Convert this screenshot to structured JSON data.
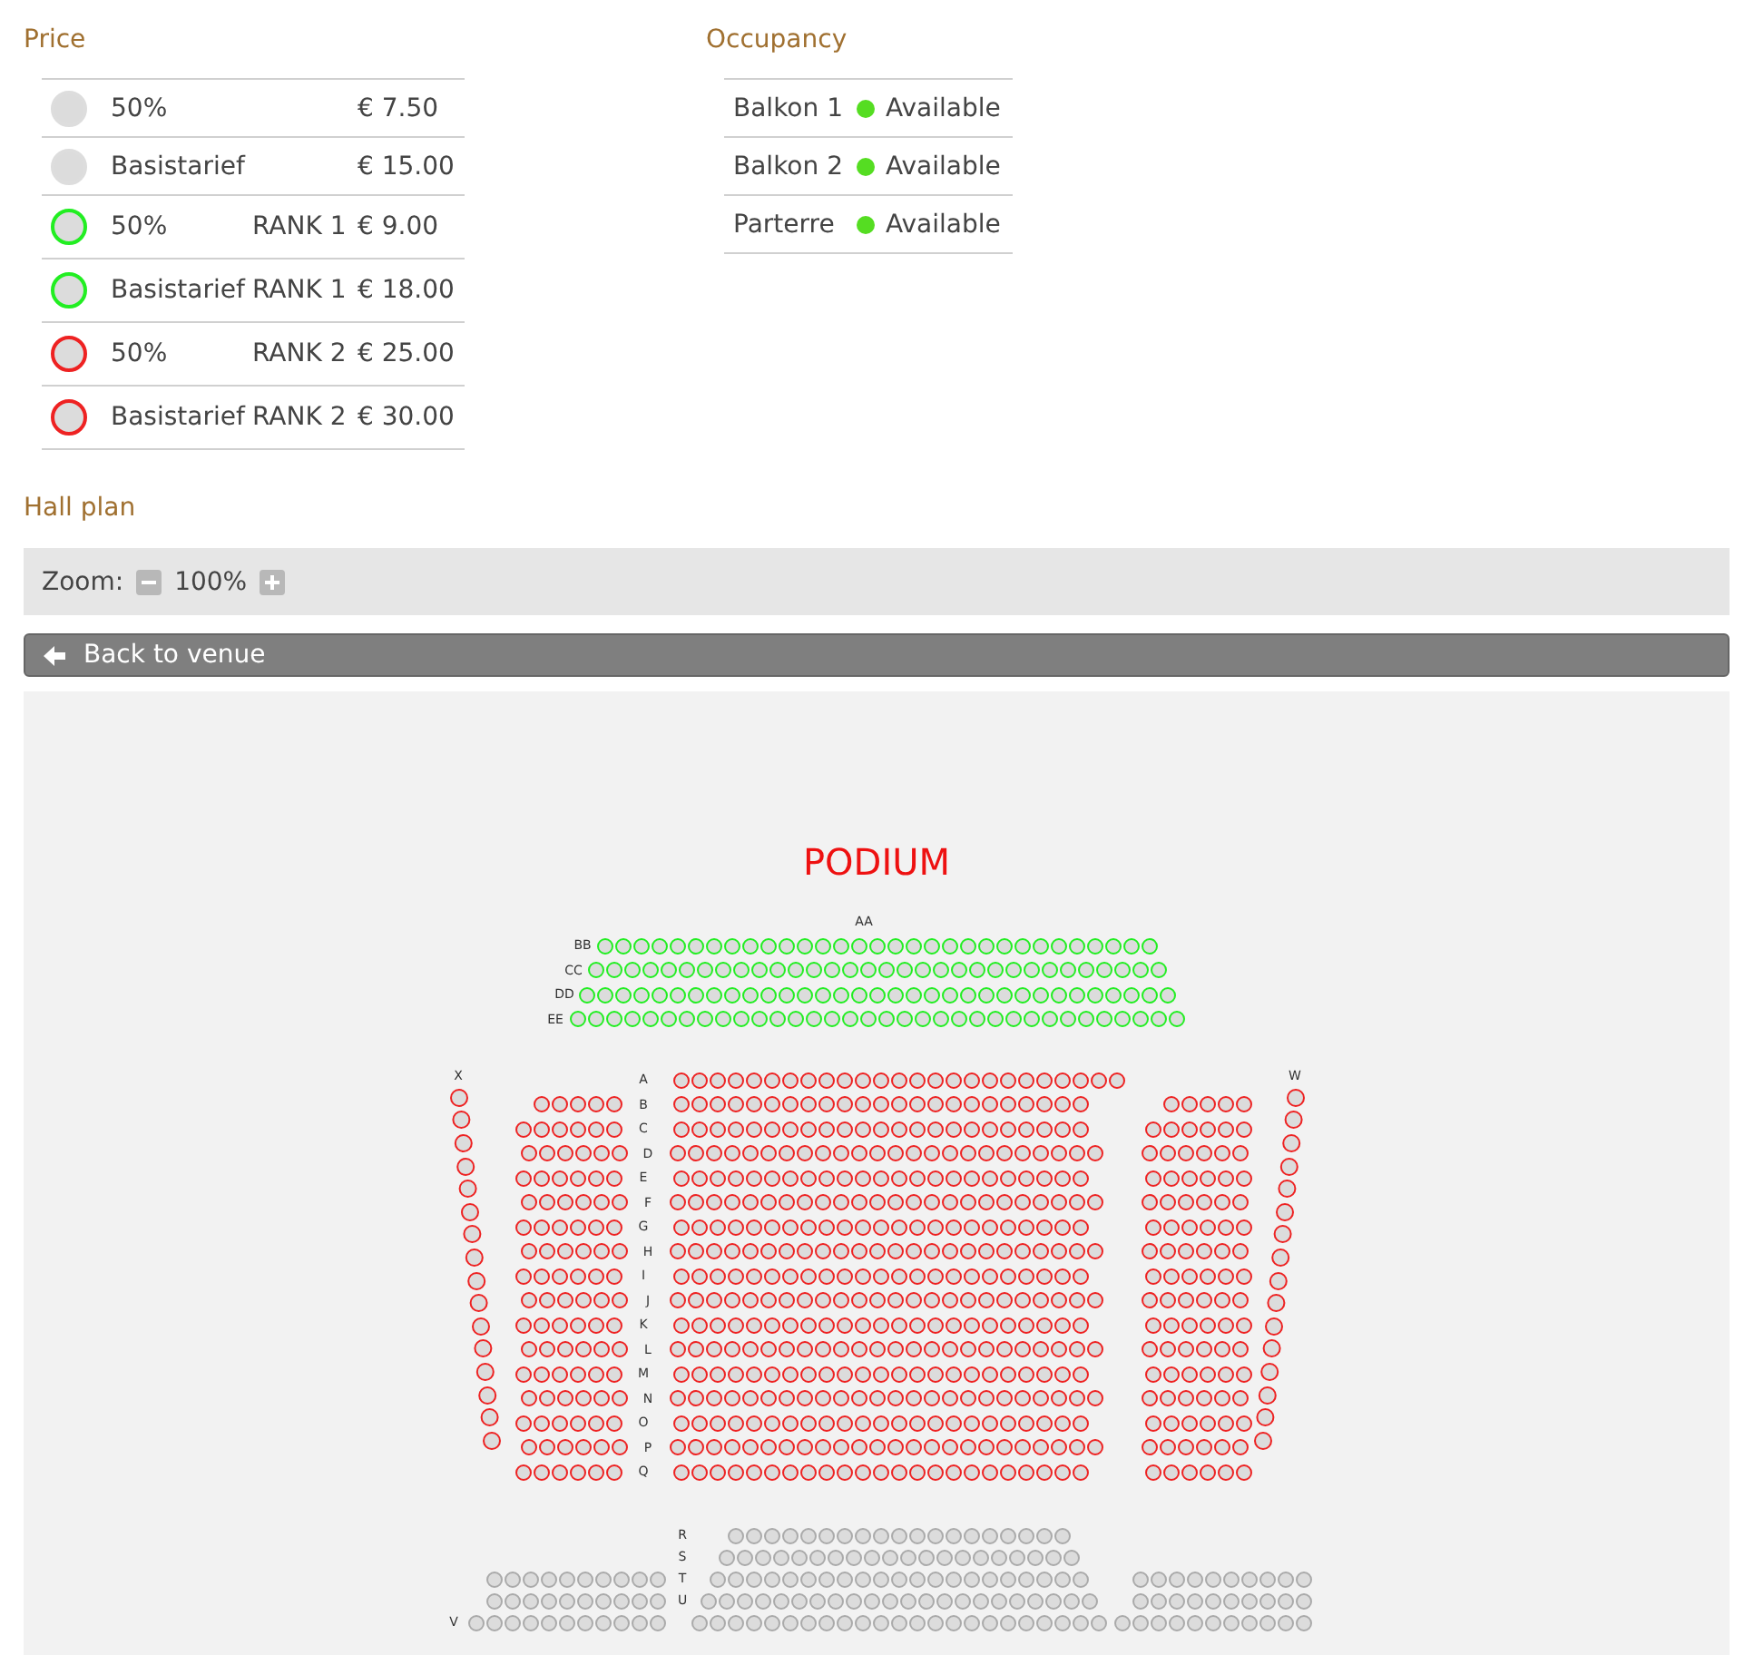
{
  "price": {
    "title": "Price",
    "items": [
      {
        "color": "#dddddd",
        "name": "50%",
        "price": "€ 7.50"
      },
      {
        "color": "#dddddd",
        "name": "Basistarief",
        "price": "€ 15.00"
      },
      {
        "color": "#22ee22",
        "name": "50%",
        "rank": "RANK 1",
        "price": "€ 9.00"
      },
      {
        "color": "#22ee22",
        "name": "Basistarief",
        "rank": "RANK 1",
        "price": "€ 18.00"
      },
      {
        "color": "#ee2222",
        "name": "50%",
        "rank": "RANK 2",
        "price": "€ 25.00"
      },
      {
        "color": "#ee2222",
        "name": "Basistarief",
        "rank": "RANK 2",
        "price": "€ 30.00"
      }
    ]
  },
  "occupancy": {
    "title": "Occupancy",
    "items": [
      {
        "name": "Balkon 1",
        "status": "Available",
        "color": "#55dd22"
      },
      {
        "name": "Balkon 2",
        "status": "Available",
        "color": "#55dd22"
      },
      {
        "name": "Parterre",
        "status": "Available",
        "color": "#55dd22"
      }
    ]
  },
  "hall_plan": {
    "title": "Hall plan",
    "zoom_label": "Zoom:",
    "zoom_value": "100%",
    "back_button": "Back to venue",
    "stage": "PODIUM",
    "balcony_rows": [
      {
        "label": "AA"
      },
      {
        "label": "BB",
        "color": "#22ee22"
      },
      {
        "label": "CC",
        "color": "#22ee22"
      },
      {
        "label": "DD",
        "color": "#22ee22"
      },
      {
        "label": "EE",
        "color": "#22ee22"
      }
    ],
    "side_aisles": [
      {
        "label": "X",
        "color": "#ee2222"
      },
      {
        "label": "W",
        "color": "#ee2222"
      }
    ],
    "main_rows": [
      {
        "label": "A",
        "color": "#ee2222"
      },
      {
        "label": "B",
        "color": "#ee2222"
      },
      {
        "label": "C",
        "color": "#ee2222"
      },
      {
        "label": "D",
        "color": "#ee2222"
      },
      {
        "label": "E",
        "color": "#ee2222"
      },
      {
        "label": "F",
        "color": "#ee2222"
      },
      {
        "label": "G",
        "color": "#ee2222"
      },
      {
        "label": "H",
        "color": "#ee2222"
      },
      {
        "label": "I",
        "color": "#ee2222"
      },
      {
        "label": "J",
        "color": "#ee2222"
      },
      {
        "label": "K",
        "color": "#ee2222"
      },
      {
        "label": "L",
        "color": "#ee2222"
      },
      {
        "label": "M",
        "color": "#ee2222"
      },
      {
        "label": "N",
        "color": "#ee2222"
      },
      {
        "label": "O",
        "color": "#ee2222"
      },
      {
        "label": "P",
        "color": "#ee2222"
      },
      {
        "label": "Q",
        "color": "#ee2222"
      }
    ],
    "rear_rows": [
      {
        "label": "R",
        "color": "#aaaaaa"
      },
      {
        "label": "S",
        "color": "#aaaaaa"
      },
      {
        "label": "T",
        "color": "#aaaaaa"
      },
      {
        "label": "U",
        "color": "#aaaaaa"
      },
      {
        "label": "V",
        "color": "#aaaaaa"
      }
    ]
  }
}
